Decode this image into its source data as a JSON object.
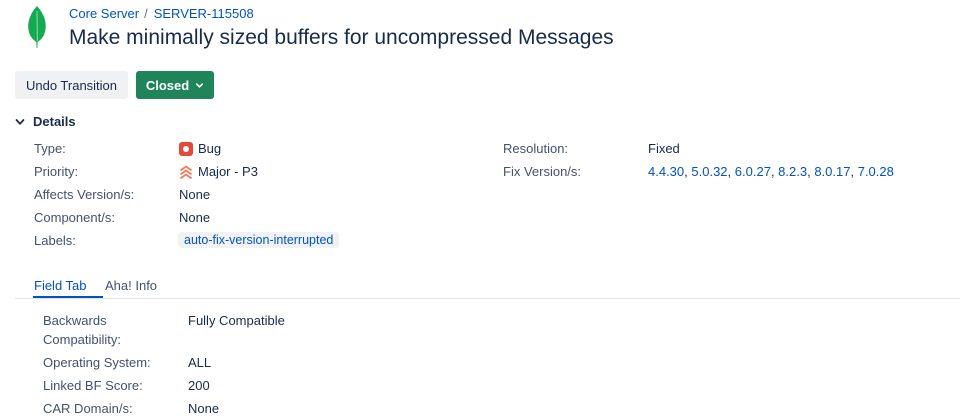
{
  "breadcrumb": {
    "project": "Core Server",
    "separator": "/",
    "issue_key": "SERVER-115508"
  },
  "issue": {
    "title": "Make minimally sized buffers for uncompressed Messages"
  },
  "toolbar": {
    "undo_label": "Undo Transition",
    "status_label": "Closed"
  },
  "details": {
    "heading": "Details",
    "type_label": "Type:",
    "type_value": "Bug",
    "priority_label": "Priority:",
    "priority_value": "Major - P3",
    "affects_label": "Affects Version/s:",
    "affects_value": "None",
    "component_label": "Component/s:",
    "component_value": "None",
    "labels_label": "Labels:",
    "labels_value": "auto-fix-version-interrupted",
    "resolution_label": "Resolution:",
    "resolution_value": "Fixed",
    "fix_label": "Fix Version/s:",
    "fix_versions": [
      "4.4.30",
      "5.0.32",
      "6.0.27",
      "8.2.3",
      "8.0.17",
      "7.0.28"
    ]
  },
  "tabs": {
    "field_tab": "Field Tab",
    "aha_info": "Aha! Info"
  },
  "fields": {
    "backwards_label_1": "Backwards",
    "backwards_label_2": "Compatibility:",
    "backwards_value": "Fully Compatible",
    "os_label": "Operating System:",
    "os_value": "ALL",
    "bf_label": "Linked BF Score:",
    "bf_value": "200",
    "car_label": "CAR Domain/s:",
    "car_value": "None"
  },
  "colors": {
    "link": "#0052cc",
    "status_green": "#1f845a",
    "bug_red": "#e5493a",
    "priority_orange": "#ff7452"
  },
  "icons": [
    "mongodb-leaf-logo",
    "chevron-down-icon",
    "bug-icon",
    "priority-major-icon"
  ]
}
